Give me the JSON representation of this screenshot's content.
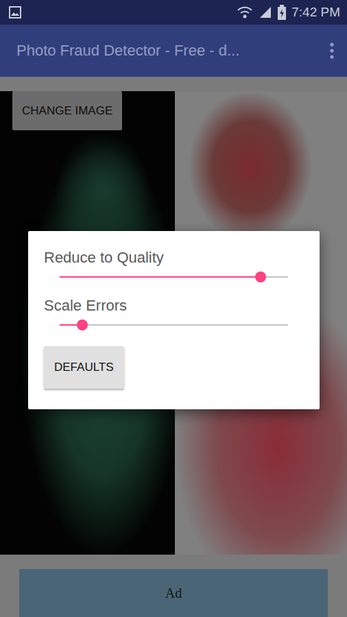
{
  "status_bar": {
    "time": "7:42 PM"
  },
  "app_bar": {
    "title": "Photo Fraud Detector - Free - d..."
  },
  "image_area": {
    "change_button": "CHANGE IMAGE"
  },
  "dialog": {
    "sliders": [
      {
        "label": "Reduce to Quality",
        "level": 0.88
      },
      {
        "label": "Scale Errors",
        "level": 0.1
      }
    ],
    "button": "DEFAULTS"
  },
  "ad": {
    "label": "Ad"
  }
}
